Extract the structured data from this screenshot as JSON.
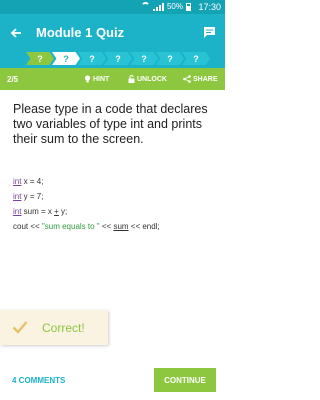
{
  "status_bar": {
    "battery": "50%",
    "time": "17:30"
  },
  "app_bar": {
    "title": "Module 1 Quiz"
  },
  "progress": {
    "steps": [
      "?",
      "?",
      "?",
      "?",
      "?",
      "?",
      "?"
    ],
    "current_index": 1
  },
  "toolbar": {
    "counter": "2/5",
    "hint": "HINT",
    "unlock": "UNLOCK",
    "share": "SHARE"
  },
  "question": {
    "text": "Please type in a code that declares two variables of type int and prints their sum to the screen."
  },
  "code": {
    "line1_kw": "int",
    "line1_rest": " x = 4;",
    "line2_kw": "int",
    "line2_rest": " y = 7;",
    "line3_kw": "int",
    "line3_a": " sum = x ",
    "line3_op": "+",
    "line3_b": " y;",
    "line4_a": "cout << ",
    "line4_str": "\"sum equals to \"",
    "line4_b": " << ",
    "line4_var": "sum",
    "line4_c": " << endl;"
  },
  "toast": {
    "message": "Correct!"
  },
  "footer": {
    "comments": "4 COMMENTS",
    "continue": "CONTINUE"
  },
  "colors": {
    "teal": "#1cb3c8",
    "green": "#8dc63f",
    "toast_bg": "#fbf3e2"
  }
}
